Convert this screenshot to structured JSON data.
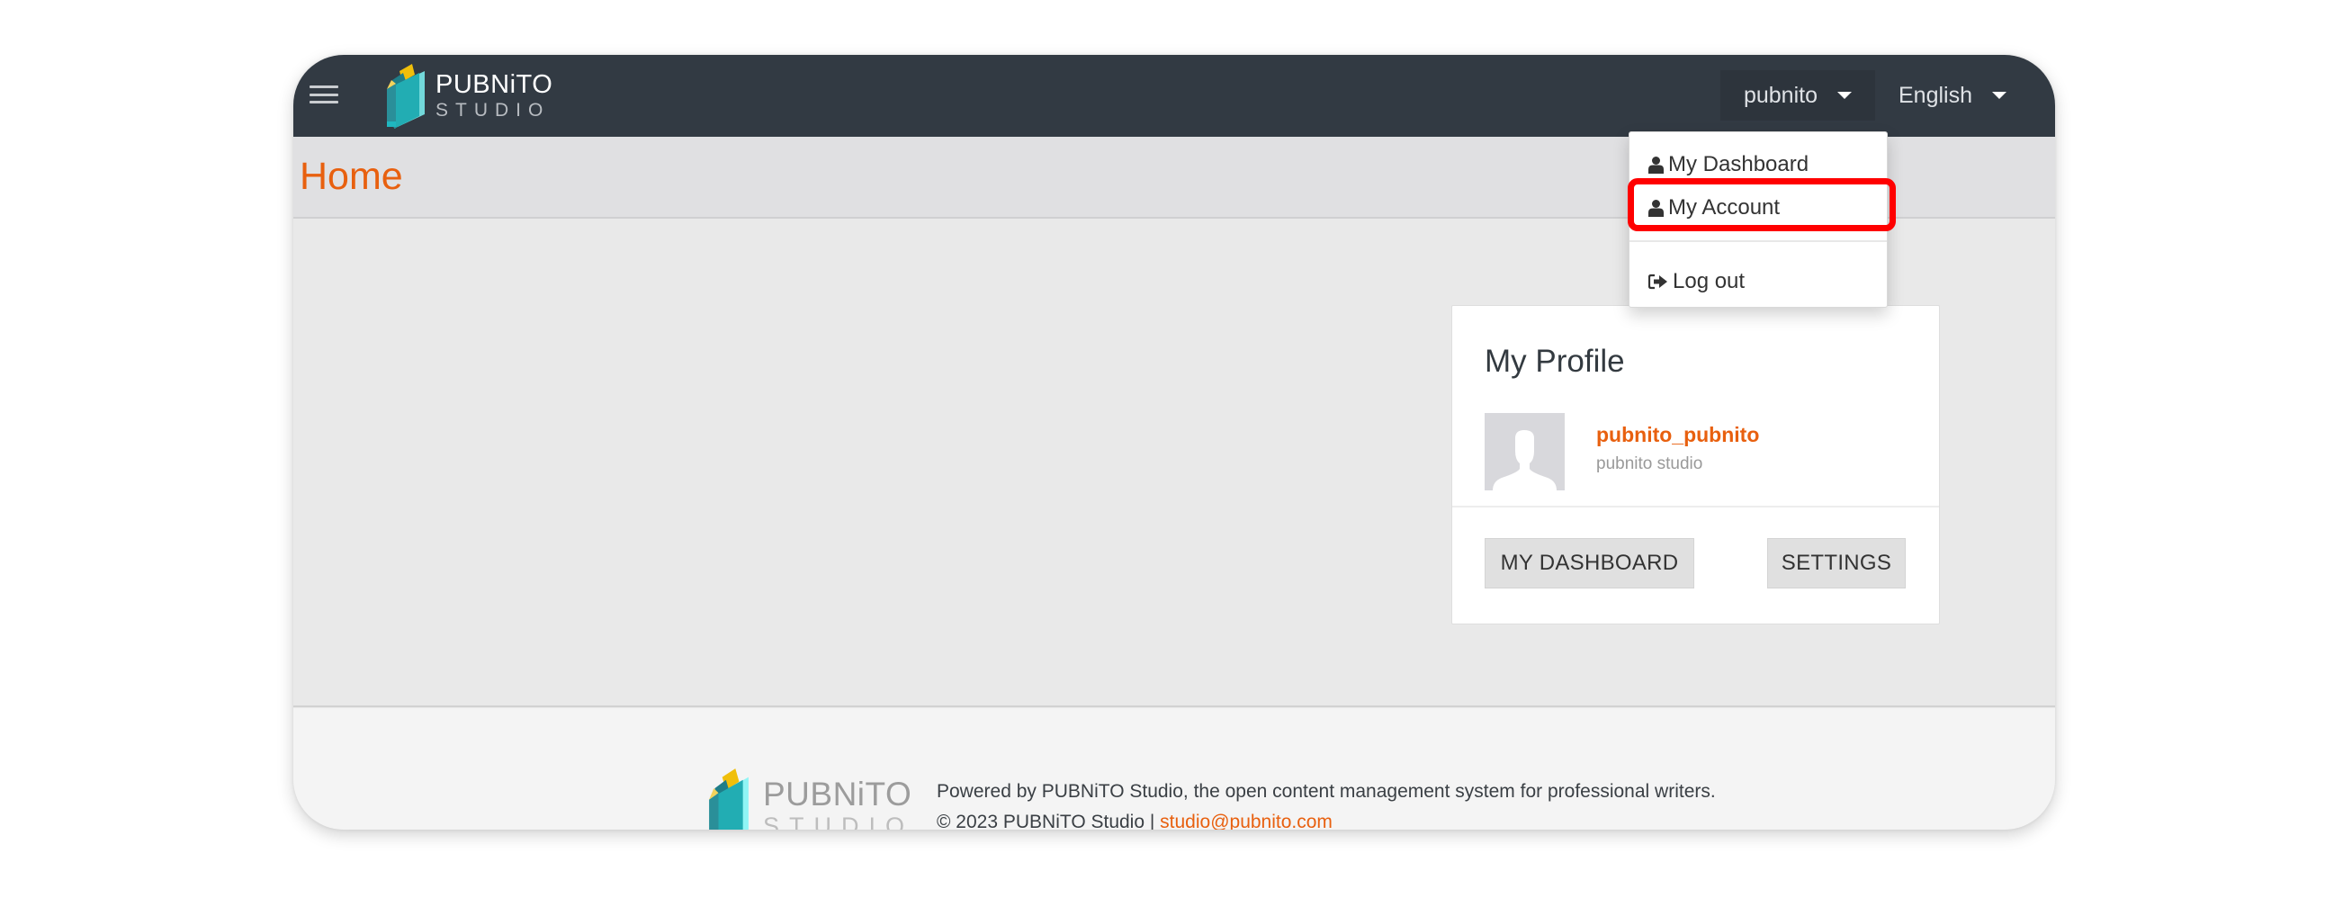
{
  "navbar": {
    "brand_line1": "PUBNiTO",
    "brand_line2": "STUDIO",
    "user_menu_label": "pubnito",
    "language_label": "English"
  },
  "page": {
    "title": "Home"
  },
  "user_dropdown": {
    "items": [
      {
        "label": "My Dashboard",
        "icon": "user-icon"
      },
      {
        "label": "My Account",
        "icon": "user-icon",
        "highlighted": true
      },
      {
        "label": "Log out",
        "icon": "sign-out-icon"
      }
    ],
    "highlight_color": "#ff0000"
  },
  "profile_card": {
    "title": "My Profile",
    "username": "pubnito_pubnito",
    "organization": "pubnito studio",
    "buttons": {
      "dashboard": "MY DASHBOARD",
      "settings": "SETTINGS"
    }
  },
  "footer": {
    "brand_line1": "PUBNiTO",
    "brand_line2": "STUDIO",
    "powered_text": "Powered by PUBNiTO Studio, the open content management system for professional writers.",
    "copyright_text": "© 2023 PUBNiTO Studio | ",
    "email": "studio@pubnito.com"
  },
  "colors": {
    "accent": "#e8600f",
    "navbar_bg": "#323a43",
    "page_header_bg": "#e0e0e2",
    "content_bg": "#e9e9e9",
    "footer_bg": "#f4f4f4"
  }
}
